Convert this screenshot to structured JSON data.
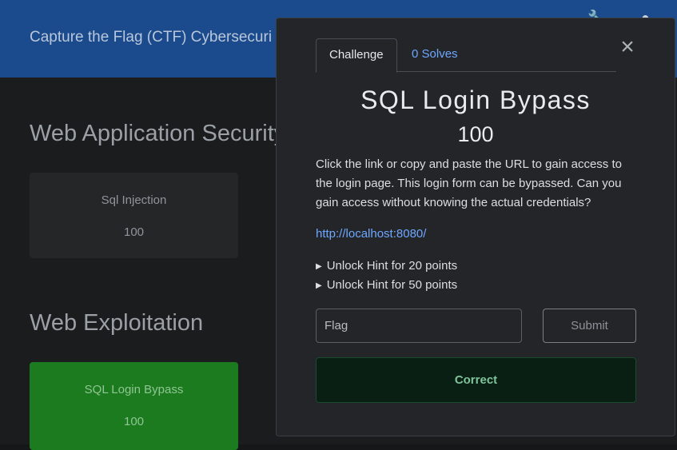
{
  "header": {
    "title": "Capture the Flag (CTF) Cybersecuri"
  },
  "sections": [
    {
      "title": "Web Application Security",
      "cards": [
        {
          "name": "Sql Injection",
          "value": "100"
        }
      ]
    },
    {
      "title": "Web Exploitation",
      "cards": [
        {
          "name": "SQL Login Bypass",
          "value": "100",
          "status": "solved"
        }
      ]
    }
  ],
  "modal": {
    "tabs": [
      {
        "label": "Challenge"
      },
      {
        "label": "0 Solves"
      }
    ],
    "challenge_name": "SQL Login Bypass",
    "challenge_value": "100",
    "description": "Click the link or copy and paste the URL to gain access to the login page. This login form can be bypassed. Can you gain access without knowing the actual credentials?",
    "url": "http://localhost:8080/",
    "hints": [
      {
        "label": "Unlock Hint for 20 points"
      },
      {
        "label": "Unlock Hint for 50 points"
      }
    ],
    "flag_placeholder": "Flag",
    "submit_label": "Submit",
    "result_text": "Correct"
  },
  "colors": {
    "header": "#1b4b8c",
    "solved_card": "#1c7a1f",
    "link": "#6ea8fe",
    "correct_bg": "#0a1f13"
  }
}
